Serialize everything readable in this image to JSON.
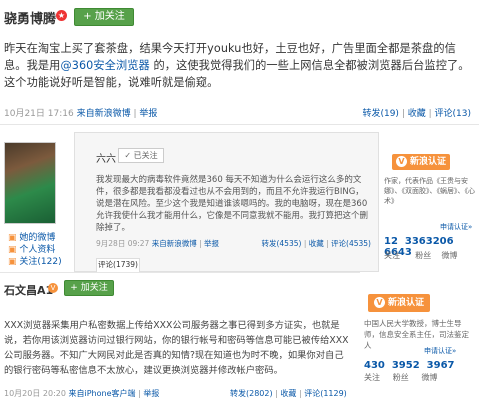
{
  "post1": {
    "username": "骁勇博腾",
    "follow_label": "+ 加关注",
    "body_pre": "昨天在淘宝上买了套茶盘，结果今天打开youku也好，土豆也好，广告里面全都是茶盘的信息。我是用",
    "body_mention": "@360安全浏览器",
    "body_post": " 的，这使我觉得我们的一些上网信息全都被浏览器后台监控了。这个功能说好听是智能，说难听就是偷窥。",
    "time": "10月21日 17:16",
    "source": "来自新浪微博",
    "report": "举报",
    "repost": "转发(19)",
    "favorite": "收藏",
    "comment": "评论(13)"
  },
  "post2": {
    "side_links": [
      "她的微博",
      "个人资料",
      "关注(122)"
    ],
    "username": "六六",
    "followed_label": "已关注",
    "body": "我发现最大的病毒软件竟然是360 每天不知道为什么会运行这么多的文件，很多都是我看都没看过也从不会用到的，而且不允许我运行BING，说是潜在风险。至少这个我是知道谁该嗯吗的。我的电脑呀，现在是360允许我使什么我才能用什么，它像是不同意我就不能用。我打算把这个删除掉了。",
    "time": "9月28日 09:27",
    "source": "来自新浪微博",
    "report": "举报",
    "repost": "转发(4535)",
    "favorite": "收藏",
    "comment": "评论(4535)",
    "comment_tab": "评论(1739)",
    "verify_badge": "新浪认证",
    "verify_text": "作家，代表作品《王贵与安娜》、《双面胶》、《蜗居》、《心术》",
    "apply": "申请认证»",
    "stats": [
      "12",
      "3363206",
      "6643"
    ],
    "stats_labels": [
      "关注",
      "粉丝",
      "微博"
    ]
  },
  "post3": {
    "username": "石文昌A1",
    "follow_label": "+ 加关注",
    "body": "XXX浏览器采集用户私密数据上传给XXX公司服务器之事已得到多方证实，也就是说，若你用该浏览器访问过银行网站，你的银行帐号和密码等信息可能已被传给XXX公司服务器。不知广大网民对此是否真的知情?现在知道也为时不晚，如果你对自己的银行密码等私密信息不太放心，建议更换浏览器并修改帐户密码。",
    "time": "10月20日 20:20",
    "source": "来自iPhone客户端",
    "report": "举报",
    "repost": "转发(2802)",
    "favorite": "收藏",
    "comment": "评论(1129)",
    "verify_badge": "新浪认证",
    "verify_text": "中国人民大学教授，博士生导师，信息安全系主任，司法鉴定人",
    "apply": "申请认证»",
    "stats": [
      "430",
      "3952",
      "3967"
    ],
    "stats_labels": [
      "关注",
      "粉丝",
      "微博"
    ]
  }
}
